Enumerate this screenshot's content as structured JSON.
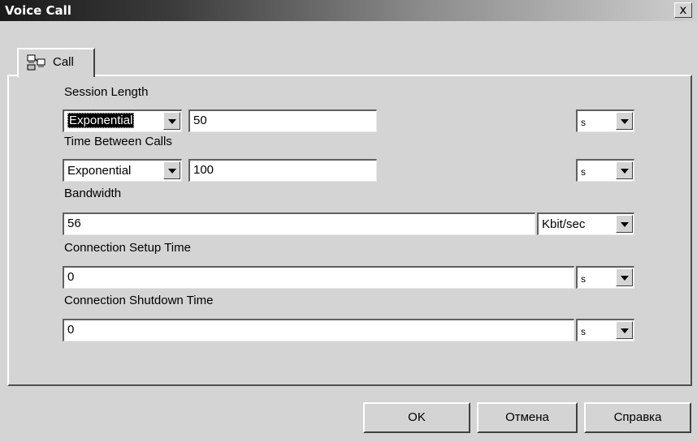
{
  "window": {
    "title": "Voice Call",
    "close_label": "x"
  },
  "tab": {
    "label": "Call",
    "icon": "network-computers-icon"
  },
  "session_length": {
    "label": "Session Length",
    "distribution": "Exponential",
    "value": "50",
    "unit": "s"
  },
  "time_between_calls": {
    "label": "Time Between Calls",
    "distribution": "Exponential",
    "value": "100",
    "unit": "s"
  },
  "bandwidth": {
    "label": "Bandwidth",
    "value": "56",
    "unit": "Kbit/sec"
  },
  "connection_setup_time": {
    "label": "Connection Setup Time",
    "value": "0",
    "unit": "s"
  },
  "connection_shutdown_time": {
    "label": "Connection Shutdown Time",
    "value": "0",
    "unit": "s"
  },
  "buttons": {
    "ok": "OK",
    "cancel": "Отмена",
    "help": "Справка"
  }
}
